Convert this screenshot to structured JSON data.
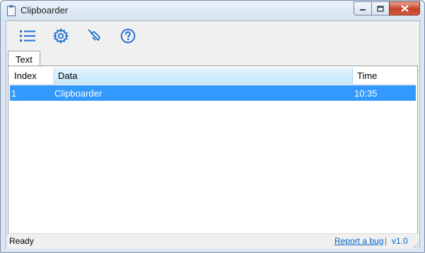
{
  "window": {
    "title": "Clipboarder",
    "icons": {
      "app": "clipboard-icon",
      "minimize": "minimize-icon",
      "maximize": "maximize-icon",
      "close": "close-icon"
    }
  },
  "toolbar": {
    "buttons": [
      {
        "icon": "list-icon"
      },
      {
        "icon": "gear-icon"
      },
      {
        "icon": "broom-icon"
      },
      {
        "icon": "help-icon"
      }
    ],
    "accent": "#1f6fcf"
  },
  "tabs": [
    {
      "label": "Text",
      "selected": true
    }
  ],
  "table": {
    "columns": {
      "index": "Index",
      "data": "Data",
      "time": "Time"
    },
    "rows": [
      {
        "index": "1",
        "data": "Clipboarder",
        "time": "10:35",
        "selected": true
      }
    ],
    "selection_color": "#3399ff"
  },
  "status": {
    "text": "Ready",
    "report_link": "Report a bug",
    "separator": "|",
    "version": "v1.0"
  }
}
